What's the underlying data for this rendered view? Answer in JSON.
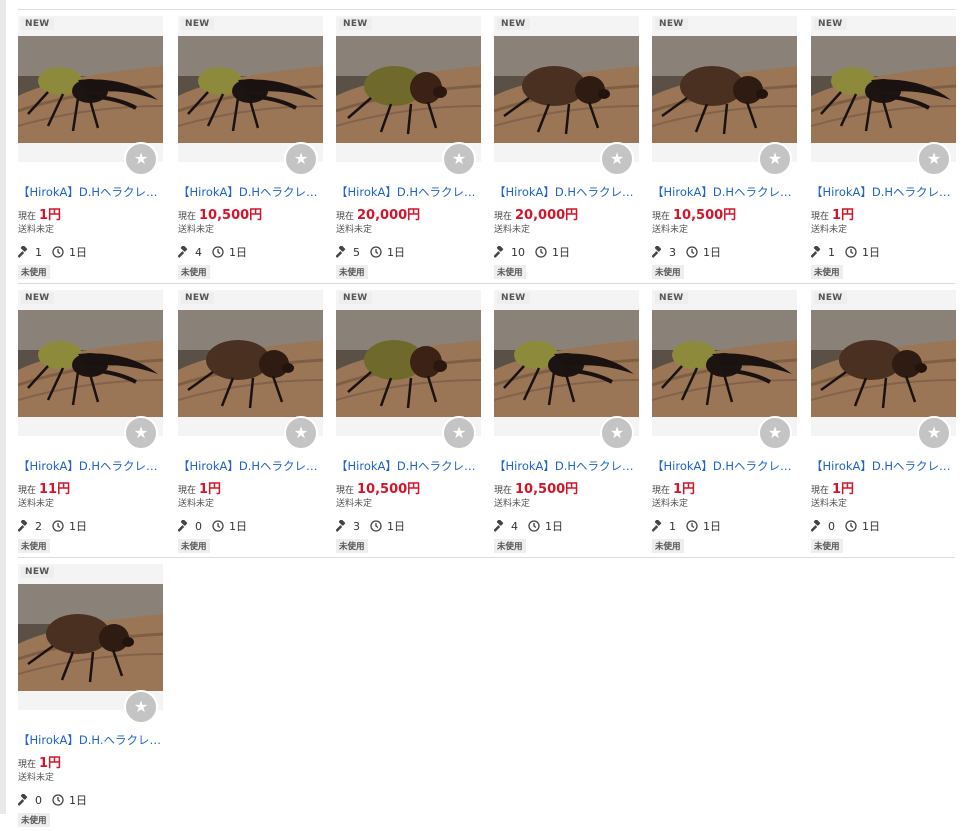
{
  "badge_new": "NEW",
  "price_label": "現在",
  "shipping": "送料未定",
  "condition": "未使用",
  "watch_glyph": "★",
  "rows": [
    [
      {
        "title": "【HirokA】D.Hヘラクレス…",
        "price": "1円",
        "bids": "1",
        "time": "1日",
        "beetle": "horned"
      },
      {
        "title": "【HirokA】D.Hヘラクレス…",
        "price": "10,500円",
        "bids": "4",
        "time": "1日",
        "beetle": "horned"
      },
      {
        "title": "【HirokA】D.Hヘラクレス…",
        "price": "20,000円",
        "bids": "5",
        "time": "1日",
        "beetle": "female-yellow"
      },
      {
        "title": "【HirokA】D.Hヘラクレ…",
        "price": "20,000円",
        "bids": "10",
        "time": "1日",
        "beetle": "female-brown"
      },
      {
        "title": "【HirokA】D.Hヘラクレ…",
        "price": "10,500円",
        "bids": "3",
        "time": "1日",
        "beetle": "female-brown"
      },
      {
        "title": "【HirokA】D.Hヘラクレ…",
        "price": "1円",
        "bids": "1",
        "time": "1日",
        "beetle": "horned"
      }
    ],
    [
      {
        "title": "【HirokA】D.Hヘラクレ…",
        "price": "11円",
        "bids": "2",
        "time": "1日",
        "beetle": "horned"
      },
      {
        "title": "【HirokA】D.Hヘラクレ…",
        "price": "1円",
        "bids": "0",
        "time": "1日",
        "beetle": "female-brown"
      },
      {
        "title": "【HirokA】D.Hヘラクレス…",
        "price": "10,500円",
        "bids": "3",
        "time": "1日",
        "beetle": "female-yellow"
      },
      {
        "title": "【HirokA】D.Hヘラクレ…",
        "price": "10,500円",
        "bids": "4",
        "time": "1日",
        "beetle": "horned"
      },
      {
        "title": "【HirokA】D.Hヘラクレ…",
        "price": "1円",
        "bids": "1",
        "time": "1日",
        "beetle": "horned"
      },
      {
        "title": "【HirokA】D.Hヘラクレ…",
        "price": "1円",
        "bids": "0",
        "time": "1日",
        "beetle": "female-brown"
      }
    ],
    [
      {
        "title": "【HirokA】D.H.ヘラクレ…",
        "price": "1円",
        "bids": "0",
        "time": "1日",
        "beetle": "female-brown"
      }
    ]
  ],
  "colors": {
    "link": "#1e63c7",
    "price": "#d4142a",
    "badge_bg": "#eeeeee",
    "watch_bg": "#c4c4c4"
  },
  "icons": {
    "bid": "gavel-icon",
    "time": "clock-icon",
    "watch": "star-icon"
  }
}
